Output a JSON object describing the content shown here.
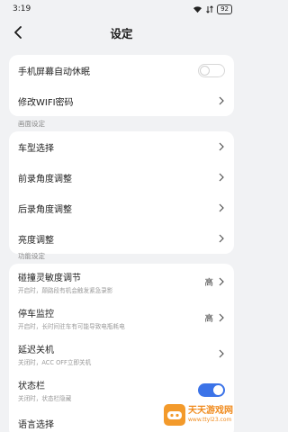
{
  "status_bar": {
    "time": "3:19",
    "battery": "92"
  },
  "header": {
    "title": "设定"
  },
  "general_card": {
    "items": [
      {
        "label": "手机屏幕自动休眠",
        "toggle": "off"
      },
      {
        "label": "修改WIFI密码"
      }
    ]
  },
  "picture_section": {
    "title": "画面设定",
    "items": [
      {
        "label": "车型选择"
      },
      {
        "label": "前录角度调整"
      },
      {
        "label": "后录角度调整"
      },
      {
        "label": "亮度调整"
      }
    ]
  },
  "function_section": {
    "title": "功能设定",
    "items": [
      {
        "label": "碰撞灵敏度调节",
        "sub": "开启时，颠路段有机会触发紧急录影",
        "value": "高"
      },
      {
        "label": "停车监控",
        "sub": "开启时，长时间驻车有可能导致电瓶耗电",
        "value": "高"
      },
      {
        "label": "延迟关机",
        "sub": "关闭时，ACC OFF立即关机"
      },
      {
        "label": "状态栏",
        "sub": "关闭时，状态栏隐藏",
        "toggle": "on"
      },
      {
        "label": "语言选择"
      }
    ]
  },
  "watermark": {
    "title": "天天游戏网",
    "url": "www.ttyl23.com"
  },
  "colors": {
    "accent": "#3b73e8",
    "background": "#f1f2f4",
    "card": "#ffffff"
  }
}
